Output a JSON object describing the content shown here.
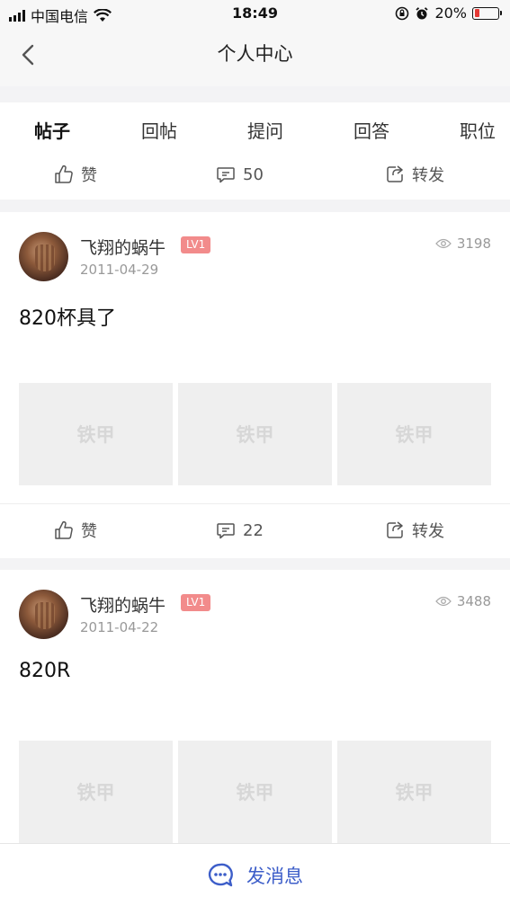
{
  "status": {
    "carrier": "中国电信",
    "time": "18:49",
    "battery_text": "20%",
    "battery_level": 0.2
  },
  "nav": {
    "title": "个人中心"
  },
  "tabs": [
    {
      "label": "帖子"
    },
    {
      "label": "回帖"
    },
    {
      "label": "提问"
    },
    {
      "label": "回答"
    },
    {
      "label": "职位"
    }
  ],
  "top_actions": {
    "like_label": "赞",
    "comment_count": "50",
    "share_label": "转发"
  },
  "posts": [
    {
      "username": "飞翔的蜗牛",
      "level": "LV1",
      "date": "2011-04-29",
      "views": "3198",
      "text": "820杯具了",
      "images": [
        "铁甲",
        "铁甲",
        "铁甲"
      ],
      "like_label": "赞",
      "comment_count": "22",
      "share_label": "转发"
    },
    {
      "username": "飞翔的蜗牛",
      "level": "LV1",
      "date": "2011-04-22",
      "views": "3488",
      "text": "820R",
      "images": [
        "铁甲",
        "铁甲",
        "铁甲"
      ]
    }
  ],
  "bottom": {
    "send_message_label": "发消息"
  },
  "colors": {
    "accent": "#3d5ec9",
    "badge": "#f28b8b",
    "battery_low": "#e53935"
  }
}
